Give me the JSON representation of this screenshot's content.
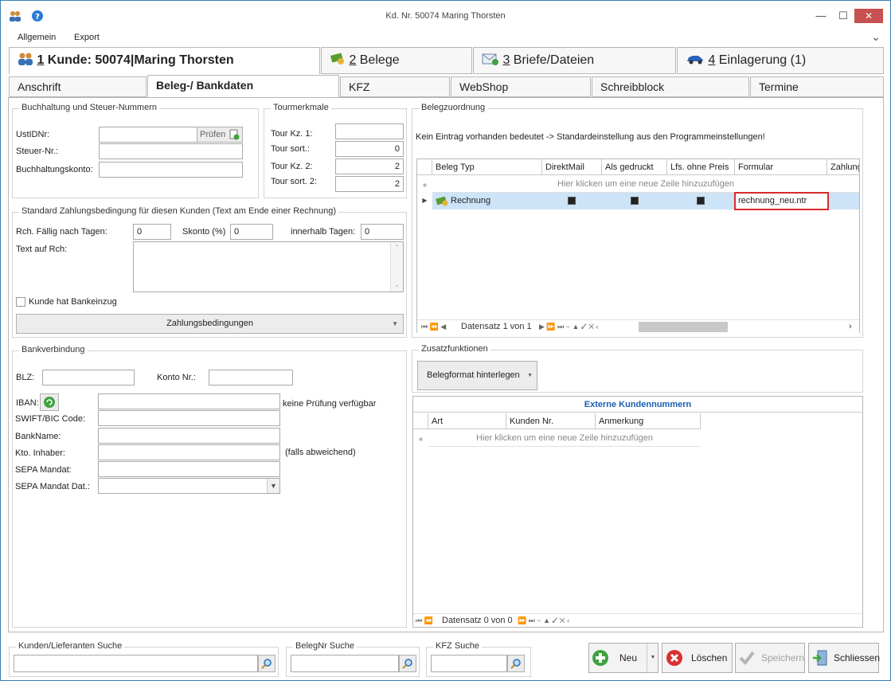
{
  "window": {
    "title": "Kd. Nr. 50074 Maring Thorsten",
    "minimize": "—",
    "maximize": "☐",
    "close": "✕"
  },
  "menu": {
    "items": [
      "Allgemein",
      "Export"
    ],
    "collapse": "⌄"
  },
  "bigtabs": [
    {
      "num": "1",
      "label": " Kunde: 50074|Maring Thorsten"
    },
    {
      "num": "2",
      "label": " Belege"
    },
    {
      "num": "3",
      "label": " Briefe/Dateien"
    },
    {
      "num": "4",
      "label": " Einlagerung (1)"
    }
  ],
  "tabs": [
    "Anschrift",
    "Beleg-/ Bankdaten",
    "KFZ",
    "WebShop",
    "Schreibblock",
    "Termine"
  ],
  "buchhaltung": {
    "title": "Buchhaltung und Steuer-Nummern",
    "ustid_label": "UstIDNr:",
    "ustid_value": "",
    "pruefen": "Prüfen",
    "steuer_label": "Steuer-Nr.:",
    "steuer_value": "",
    "konto_label": "Buchhaltungskonto:",
    "konto_value": ""
  },
  "tour": {
    "title": "Tourmerkmale",
    "rows": [
      {
        "label": "Tour Kz. 1:",
        "value": ""
      },
      {
        "label": "Tour sort.:",
        "value": "0"
      },
      {
        "label": "Tour Kz. 2:",
        "value": "2"
      },
      {
        "label": "Tour sort. 2:",
        "value": "2"
      }
    ]
  },
  "zahlung": {
    "title": "Standard Zahlungsbedingung für diesen Kunden (Text am Ende einer Rechnung)",
    "faellig_label": "Rch. Fällig nach Tagen:",
    "faellig_value": "0",
    "skonto_label": "Skonto (%)",
    "skonto_value": "0",
    "innerhalb_label": "innerhalb Tagen:",
    "innerhalb_value": "0",
    "text_label": "Text auf Rch:",
    "text_value": "",
    "bankeinzug_label": "Kunde hat Bankeinzug",
    "button": "Zahlungsbedingungen"
  },
  "bank": {
    "title": "Bankverbindung",
    "blz_label": "BLZ:",
    "blz_value": "",
    "kontonr_label": "Konto Nr.:",
    "kontonr_value": "",
    "iban_label": "IBAN:",
    "iban_value": "",
    "iban_note": "keine Prüfung verfügbar",
    "swift_label": "SWIFT/BIC Code:",
    "swift_value": "",
    "bankname_label": "BankName:",
    "bankname_value": "",
    "inhaber_label": "Kto. Inhaber:",
    "inhaber_value": "",
    "inhaber_note": "(falls abweichend)",
    "sepa_label": "SEPA Mandat:",
    "sepa_value": "",
    "sepadat_label": "SEPA Mandat Dat.:",
    "sepadat_value": ""
  },
  "belegzuordnung": {
    "title": "Belegzuordnung",
    "note": "Kein Eintrag vorhanden bedeutet -> Standardeinstellung aus den Programmeinstellungen!",
    "columns": [
      "Beleg Typ",
      "DirektMail",
      "Als gedruckt",
      "Lfs. ohne Preis",
      "Formular",
      "Zahlung"
    ],
    "new_row": "Hier klicken um eine neue Zeile hinzuzufügen",
    "rows": [
      {
        "typ": "Rechnung",
        "direktmail": true,
        "gedruckt": true,
        "ohne_preis": true,
        "formular": "rechnung_neu.ntr"
      }
    ],
    "nav_text": "Datensatz 1 von 1"
  },
  "zusatz": {
    "title": "Zusatzfunktionen",
    "button": "Belegformat hinterlegen"
  },
  "extern": {
    "title": "Externe Kundennummern",
    "columns": [
      "Art",
      "Kunden Nr.",
      "Anmerkung"
    ],
    "new_row": "Hier klicken um eine neue Zeile hinzuzufügen",
    "nav_text": "Datensatz 0 von 0"
  },
  "search": [
    {
      "label": "Kunden/Lieferanten Suche",
      "value": ""
    },
    {
      "label": "BelegNr Suche",
      "value": ""
    },
    {
      "label": "KFZ Suche",
      "value": ""
    }
  ],
  "buttons": {
    "neu": "Neu",
    "loeschen": "Löschen",
    "speichern": "Speichern",
    "schliessen": "Schliessen"
  }
}
